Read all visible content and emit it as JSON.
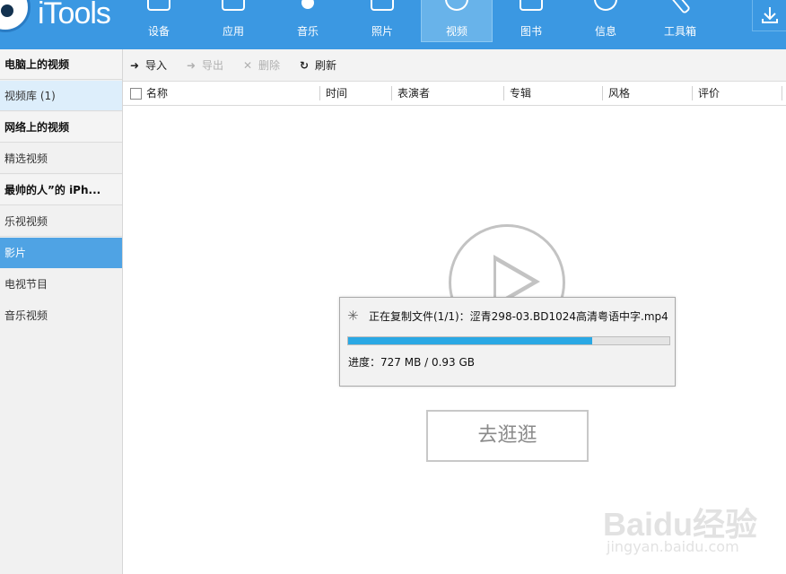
{
  "app": {
    "name": "iTools"
  },
  "nav": {
    "items": [
      {
        "label": "设备",
        "icon": "device-icon"
      },
      {
        "label": "应用",
        "icon": "apps-icon"
      },
      {
        "label": "音乐",
        "icon": "music-icon"
      },
      {
        "label": "照片",
        "icon": "photo-icon"
      },
      {
        "label": "视频",
        "icon": "video-icon",
        "active": true
      },
      {
        "label": "图书",
        "icon": "book-icon"
      },
      {
        "label": "信息",
        "icon": "message-icon"
      },
      {
        "label": "工具箱",
        "icon": "toolbox-icon"
      }
    ],
    "download_icon": "download-icon"
  },
  "sidebar": {
    "items": [
      {
        "label": "电脑上的视频",
        "type": "header"
      },
      {
        "label": "视频库 (1)",
        "type": "item"
      },
      {
        "label": "网络上的视频",
        "type": "header"
      },
      {
        "label": "精选视频",
        "type": "item"
      },
      {
        "label": "最帅的人”的 iPh...",
        "type": "header"
      },
      {
        "label": "乐视视频",
        "type": "item"
      },
      {
        "label": "影片",
        "type": "item",
        "selected": true
      },
      {
        "label": "电视节目",
        "type": "item"
      },
      {
        "label": "音乐视频",
        "type": "item"
      }
    ]
  },
  "toolbar": {
    "import_label": "导入",
    "export_label": "导出",
    "delete_label": "删除",
    "refresh_label": "刷新"
  },
  "table": {
    "columns": [
      "名称",
      "时间",
      "表演者",
      "专辑",
      "风格",
      "评价"
    ]
  },
  "empty_state": {
    "browse_label": "去逛逛"
  },
  "dialog": {
    "title": "正在复制文件(1/1)：涩青298-03.BD1024高清粤语中字.mp4",
    "status": "进度：727 MB / 0.93 GB",
    "progress": 0.76
  },
  "watermark": {
    "brand": "Baidu经验",
    "url": "jingyan.baidu.com"
  },
  "colors": {
    "topbar": "#3b98e2",
    "selected": "#4fa3e4",
    "progress": "#2aa8e4"
  }
}
